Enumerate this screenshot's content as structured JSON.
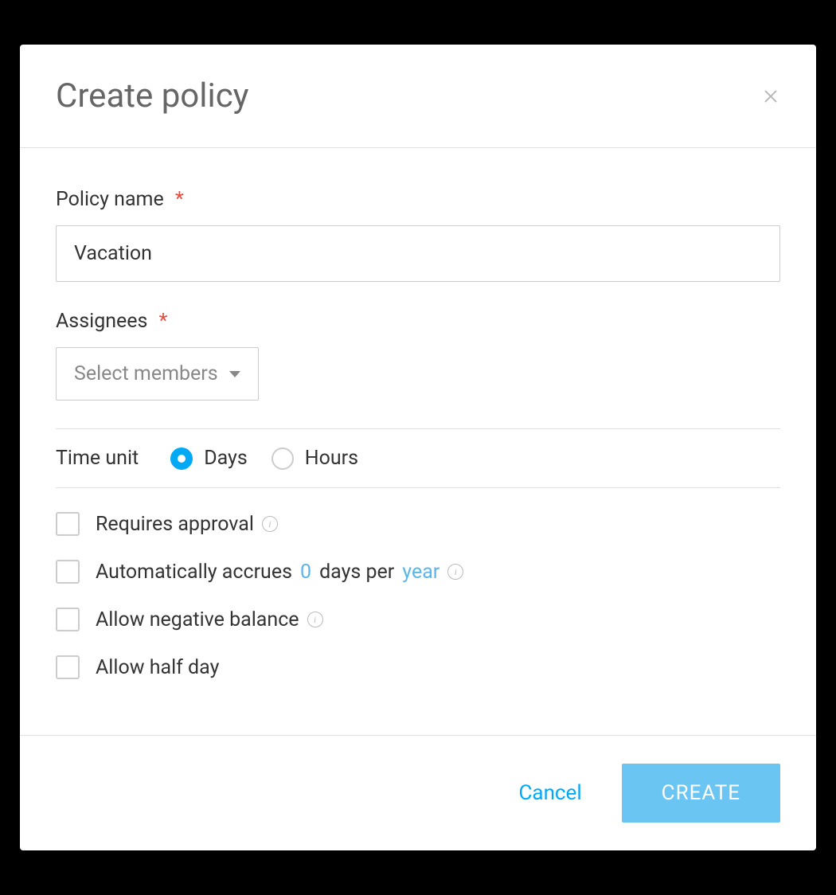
{
  "modal": {
    "title": "Create policy"
  },
  "form": {
    "policyName": {
      "label": "Policy name",
      "value": "Vacation"
    },
    "assignees": {
      "label": "Assignees",
      "placeholder": "Select members"
    },
    "timeUnit": {
      "label": "Time unit",
      "options": {
        "days": "Days",
        "hours": "Hours"
      },
      "selected": "days"
    },
    "checkboxes": {
      "requiresApproval": {
        "label": "Requires approval",
        "checked": false
      },
      "autoAccrues": {
        "labelPrefix": "Automatically accrues",
        "value": "0",
        "labelMid": "days per",
        "period": "year",
        "checked": false
      },
      "negativeBalance": {
        "label": "Allow negative balance",
        "checked": false
      },
      "halfDay": {
        "label": "Allow half day",
        "checked": false
      }
    }
  },
  "footer": {
    "cancel": "Cancel",
    "create": "CREATE"
  }
}
